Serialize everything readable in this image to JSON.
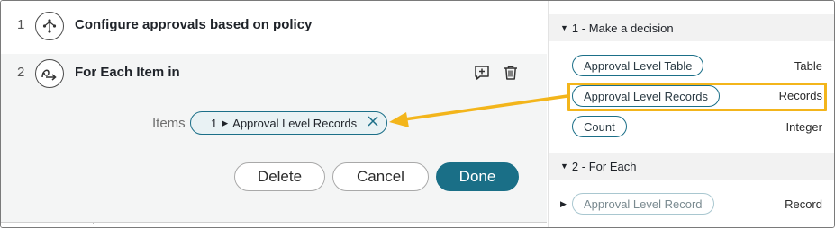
{
  "flow": {
    "steps": [
      {
        "number": "1",
        "title": "Configure approvals based on policy",
        "icon": "flow-branch-icon"
      },
      {
        "number": "2",
        "title": "For Each Item in",
        "icon": "loop-icon"
      }
    ],
    "step2": {
      "actions": {
        "comment_icon": "add-comment-icon",
        "delete_icon": "trash-icon"
      },
      "items_label": "Items",
      "items_value": {
        "step_ref": "1",
        "label": "Approval Level Records",
        "clear_icon": "close-icon"
      },
      "buttons": {
        "delete": "Delete",
        "cancel": "Cancel",
        "done": "Done"
      }
    }
  },
  "data_panel": {
    "sections": [
      {
        "title": "1 - Make a decision",
        "rows": [
          {
            "label": "Approval Level Table",
            "type": "Table"
          },
          {
            "label": "Approval Level Records",
            "type": "Records",
            "highlighted": true
          },
          {
            "label": "Count",
            "type": "Integer"
          }
        ]
      },
      {
        "title": "2 - For Each",
        "rows": [
          {
            "label": "Approval Level Record",
            "type": "Record",
            "muted": true
          }
        ]
      }
    ]
  },
  "colors": {
    "accent": "#1a6f87",
    "callout": "#f3b51b",
    "panel_bg": "#f4f5f5"
  }
}
